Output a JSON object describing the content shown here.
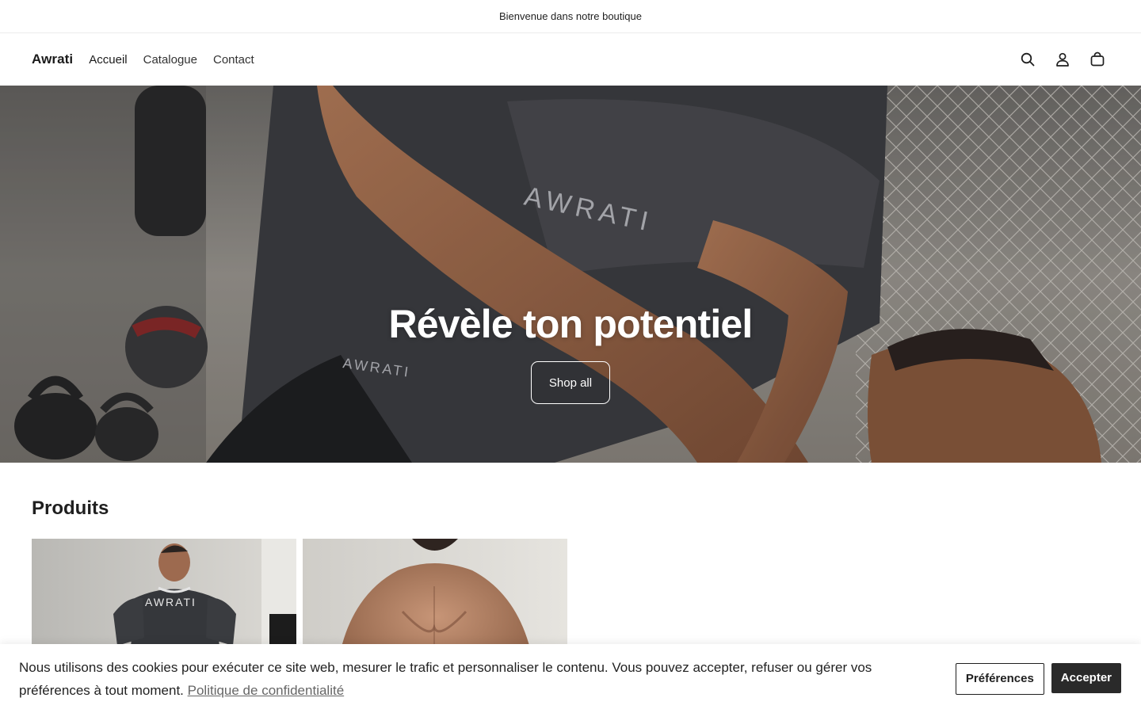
{
  "announcement": {
    "text": "Bienvenue dans notre boutique"
  },
  "header": {
    "brand": "Awrati",
    "nav": [
      {
        "label": "Accueil"
      },
      {
        "label": "Catalogue"
      },
      {
        "label": "Contact"
      }
    ],
    "icons": [
      "search-icon",
      "account-icon",
      "cart-icon"
    ]
  },
  "hero": {
    "title": "Révèle ton potentiel",
    "cta": "Shop all",
    "brand_print": "AWRATI"
  },
  "products": {
    "title": "Produits",
    "items": [
      {
        "image_text": "AWRATI"
      },
      {
        "image_text": ""
      }
    ]
  },
  "cookie_banner": {
    "text": "Nous utilisons des cookies pour exécuter ce site web, mesurer le trafic et personnaliser le contenu. Vous pouvez accepter, refuser ou gérer vos préférences à tout moment.",
    "link": "Politique de confidentialité",
    "preferences_label": "Préférences",
    "accept_label": "Accepter"
  },
  "colors": {
    "accent_dark": "#2a2a2a",
    "text": "#1f1f1f",
    "hero_text": "#ffffff"
  }
}
